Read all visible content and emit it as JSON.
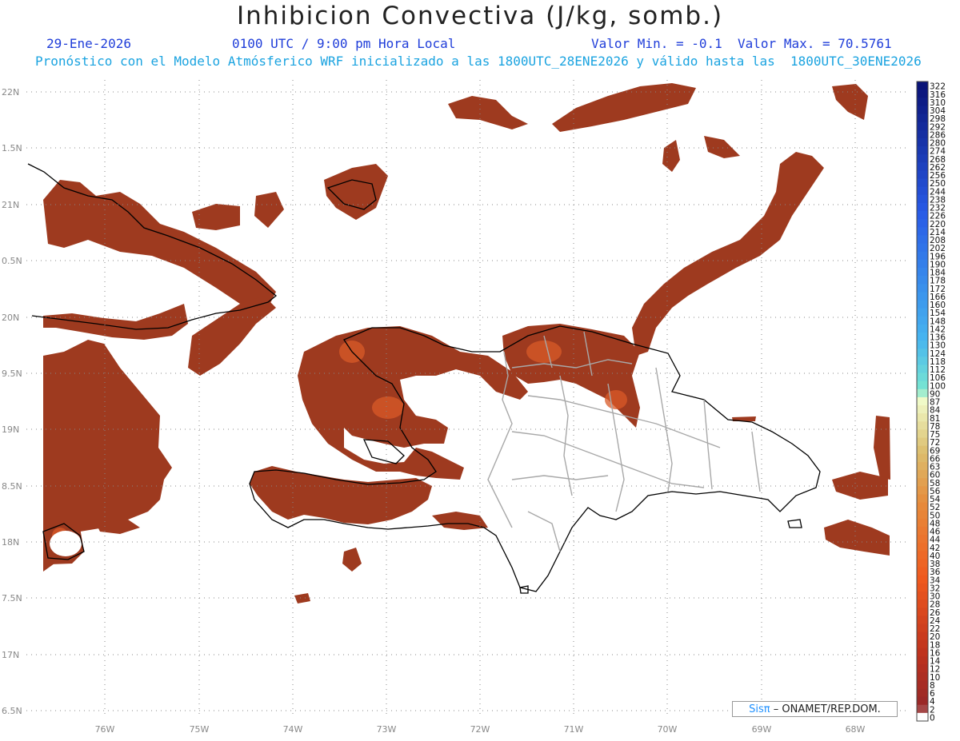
{
  "header": {
    "title": "Inhibicion Convectiva (J/kg, somb.)",
    "date": "29-Ene-2026",
    "time": "0100 UTC / 9:00 pm Hora Local",
    "minmax": "Valor Min. = -0.1  Valor Max. = 70.5761",
    "forecast": "Pronóstico con el Modelo Atmósferico WRF inicializado a las 1800UTC_28ENE2026 y válido hasta las  1800UTC_30ENE2026"
  },
  "map": {
    "lat_labels": [
      "22N",
      "1.5N",
      "21N",
      "0.5N",
      "20N",
      "9.5N",
      "19N",
      "8.5N",
      "18N",
      "7.5N",
      "17N",
      "6.5N"
    ],
    "lon_labels": [
      "76W",
      "75W",
      "74W",
      "73W",
      "72W",
      "71W",
      "70W",
      "69W",
      "68W"
    ],
    "shade_color": "#9e3a1f",
    "highlight_color": "#e06a2a"
  },
  "colorbar": {
    "labels": [
      "322",
      "316",
      "310",
      "304",
      "298",
      "292",
      "286",
      "280",
      "274",
      "268",
      "262",
      "256",
      "250",
      "244",
      "238",
      "232",
      "226",
      "220",
      "214",
      "208",
      "202",
      "196",
      "190",
      "184",
      "178",
      "172",
      "166",
      "160",
      "154",
      "148",
      "142",
      "136",
      "130",
      "124",
      "118",
      "112",
      "106",
      "100",
      "90",
      "87",
      "84",
      "81",
      "78",
      "75",
      "72",
      "69",
      "66",
      "63",
      "60",
      "58",
      "56",
      "54",
      "52",
      "50",
      "48",
      "46",
      "44",
      "42",
      "40",
      "38",
      "36",
      "34",
      "32",
      "30",
      "28",
      "26",
      "24",
      "22",
      "20",
      "18",
      "16",
      "14",
      "12",
      "10",
      "8",
      "6",
      "4",
      "2",
      "0"
    ]
  },
  "credit": {
    "sis": "Sisπ",
    "text": "– ONAMET/REP.DOM."
  }
}
